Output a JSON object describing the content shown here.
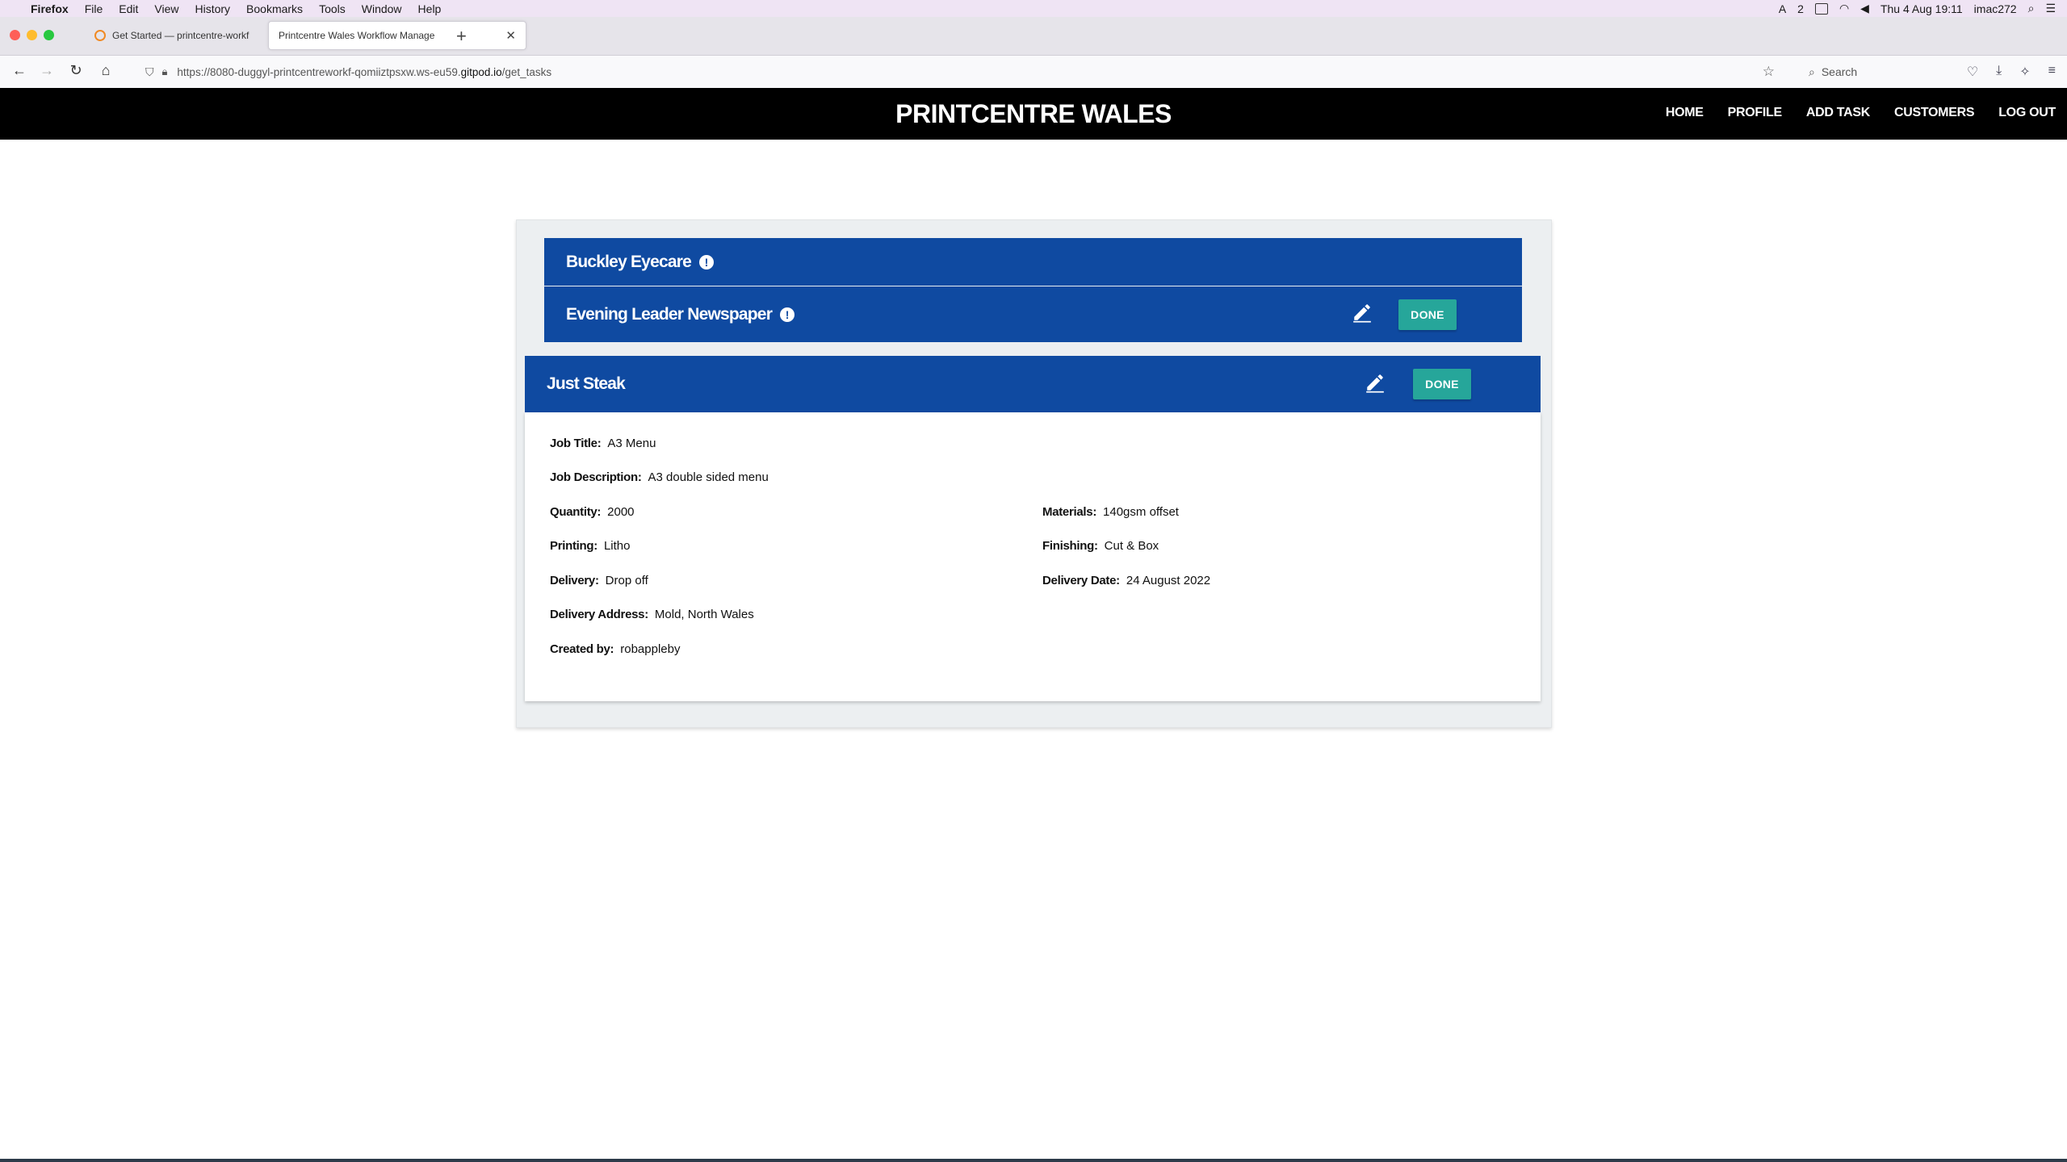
{
  "macos": {
    "menus": [
      "Firefox",
      "File",
      "Edit",
      "View",
      "History",
      "Bookmarks",
      "Tools",
      "Window",
      "Help"
    ],
    "status_badge": "2",
    "clock": "Thu 4 Aug  19:11",
    "user": "imac272"
  },
  "browser": {
    "tabs": [
      {
        "title": "Get Started — printcentre-workf"
      },
      {
        "title": "Printcentre Wales Workflow Manage"
      }
    ],
    "url_prefix": "https://8080-duggyl-printcentreworkf-qomiiztpsxw.ws-eu59.",
    "url_host": "gitpod.io",
    "url_path": "/get_tasks",
    "search_placeholder": "Search"
  },
  "site": {
    "brand": "PRINTCENTRE WALES",
    "nav": [
      "HOME",
      "PROFILE",
      "ADD TASK",
      "CUSTOMERS",
      "LOG OUT"
    ]
  },
  "tasks": [
    {
      "customer": "Buckley Eyecare",
      "urgent": true
    },
    {
      "customer": "Evening Leader Newspaper",
      "urgent": true,
      "done_label": "DONE"
    },
    {
      "customer": "Just Steak",
      "done_label": "DONE",
      "details": {
        "job_title": {
          "label": "Job Title:",
          "value": "A3 Menu"
        },
        "job_description": {
          "label": "Job Description:",
          "value": "A3 double sided menu"
        },
        "quantity": {
          "label": "Quantity:",
          "value": "2000"
        },
        "materials": {
          "label": "Materials:",
          "value": "140gsm offset"
        },
        "printing": {
          "label": "Printing:",
          "value": "Litho"
        },
        "finishing": {
          "label": "Finishing:",
          "value": "Cut & Box"
        },
        "delivery": {
          "label": "Delivery:",
          "value": "Drop off"
        },
        "delivery_date": {
          "label": "Delivery Date:",
          "value": "24 August 2022"
        },
        "delivery_address": {
          "label": "Delivery Address:",
          "value": "Mold, North Wales"
        },
        "created_by": {
          "label": "Created by:",
          "value": "robappleby"
        }
      }
    }
  ],
  "colors": {
    "header_bg": "#000000",
    "task_header_bg": "#0f4aa1",
    "done_button_bg": "#26a69a",
    "panel_bg": "#eceff1"
  }
}
